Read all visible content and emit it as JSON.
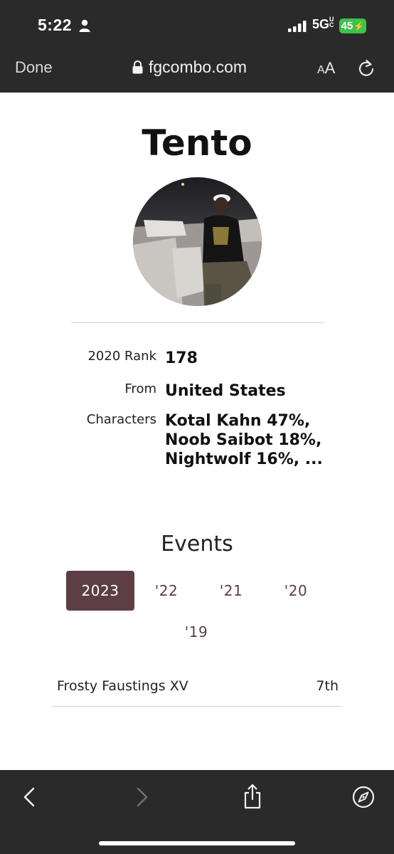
{
  "status_bar": {
    "time": "5:22",
    "network": "5G",
    "network_suffix": "UC",
    "battery": "45",
    "icons": [
      "person-icon",
      "signal-icon",
      "bolt-icon"
    ]
  },
  "browser": {
    "done_label": "Done",
    "url": "fgcombo.com",
    "aa_small": "A",
    "aa_big": "A",
    "icons": [
      "lock-icon",
      "reload-icon"
    ]
  },
  "profile": {
    "name": "Tento",
    "rows": [
      {
        "label": "2020 Rank",
        "value": "178"
      },
      {
        "label": "From",
        "value": "United States"
      },
      {
        "label": "Characters",
        "value_lines": [
          "Kotal Kahn 47%,",
          "Noob Saibot 18%,",
          "Nightwolf 16%, ..."
        ]
      }
    ]
  },
  "events": {
    "title": "Events",
    "years": [
      "2023",
      "'22",
      "'21",
      "'20",
      "'19"
    ],
    "active_year": "2023",
    "list": [
      {
        "name": "Frosty Faustings XV",
        "place": "7th"
      }
    ]
  },
  "toolbar": {
    "icons": [
      "back-icon",
      "forward-icon",
      "share-icon",
      "compass-icon"
    ]
  },
  "colors": {
    "bar_background": "#2a2a2a",
    "active_tab": "#5c3e44",
    "battery": "#3fc24a"
  }
}
